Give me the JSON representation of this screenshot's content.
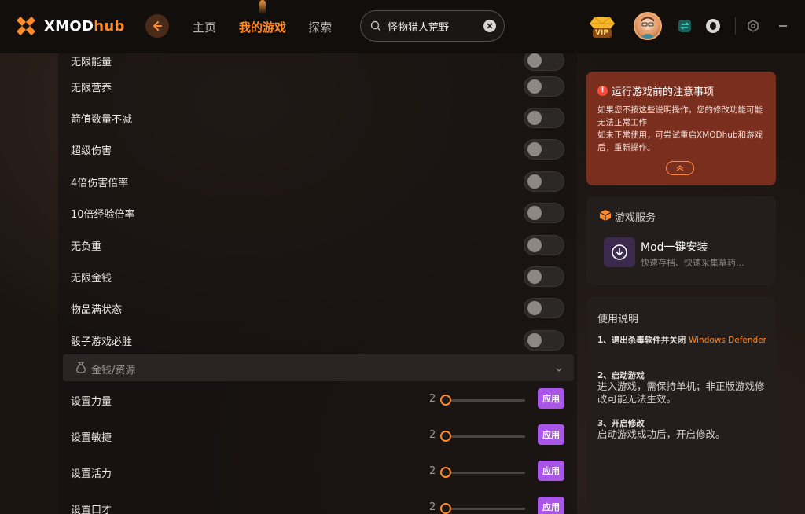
{
  "header": {
    "logo_text": "XMOD",
    "logo_accent": "hub",
    "nav": [
      "主页",
      "我的游戏",
      "探索"
    ],
    "active_nav": 1,
    "search_value": "怪物猎人荒野",
    "vip_label": "VIP"
  },
  "toggles": [
    "无限能量",
    "无限营养",
    "箭值数量不减",
    "超级伤害",
    "4倍伤害倍率",
    "10倍经验倍率",
    "无负重",
    "无限金钱",
    "物品满状态",
    "骰子游戏必胜"
  ],
  "section": {
    "label": "金钱/资源"
  },
  "sliders": [
    {
      "label": "设置力量",
      "value": "2",
      "button": "应用"
    },
    {
      "label": "设置敏捷",
      "value": "2",
      "button": "应用"
    },
    {
      "label": "设置活力",
      "value": "2",
      "button": "应用"
    },
    {
      "label": "设置口才",
      "value": "2",
      "button": "应用"
    }
  ],
  "notice": {
    "title": "运行游戏前的注意事项",
    "line1": "如果您不按这些说明操作，您的修改功能可能无法正常工作",
    "line2": "如未正常使用，可尝试重启XMODhub和游戏后，重新操作。"
  },
  "service": {
    "title": "游戏服务",
    "mod_title": "Mod一键安装",
    "mod_sub": "快速存档、快速采集草药..."
  },
  "guide": {
    "title": "使用说明",
    "step1_title": "1、退出杀毒软件并关闭",
    "step1_highlight": "Windows Defender",
    "step2_title": "2、启动游戏",
    "step2_desc": "进入游戏，需保持单机；非正版游戏修改可能无法生效。",
    "step3_title": "3、开启修改",
    "step3_desc": "启动游戏成功后，开启修改。"
  },
  "colors": {
    "accent": "#ff8a2a",
    "apply": "#a855e8",
    "notice_bg": "#7a2e1e"
  }
}
